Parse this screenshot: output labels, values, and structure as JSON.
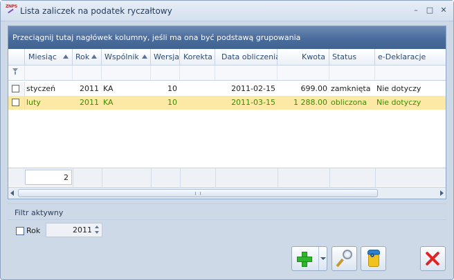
{
  "window": {
    "title": "Lista zaliczek na podatek ryczałtowy",
    "app_icon_label": "ZNPS",
    "controls": {
      "minimize": "–",
      "maximize": "□",
      "close": "✕"
    }
  },
  "grid": {
    "group_hint": "Przeciągnij tutaj nagłówek kolumny, jeśli ma ona być podstawą grupowania",
    "columns": [
      {
        "label": "Miesiąc",
        "sorted": "asc"
      },
      {
        "label": "Rok",
        "sorted": "asc"
      },
      {
        "label": "Wspólnik",
        "sorted": "asc"
      },
      {
        "label": "Wersja",
        "sorted": ""
      },
      {
        "label": "Korekta",
        "sorted": ""
      },
      {
        "label": "Data obliczenia",
        "sorted": ""
      },
      {
        "label": "Kwota",
        "sorted": ""
      },
      {
        "label": "Status",
        "sorted": ""
      },
      {
        "label": "e-Deklaracje",
        "sorted": ""
      }
    ],
    "rows": [
      {
        "miesiac": "styczeń",
        "rok": "2011",
        "wspolnik": "KA",
        "wersja": "10",
        "korekta": "",
        "data": "2011-02-15",
        "kwota": "699.00",
        "status": "zamknięta",
        "edeklaracje": "Nie dotyczy",
        "selected": false,
        "checked": false
      },
      {
        "miesiac": "luty",
        "rok": "2011",
        "wspolnik": "KA",
        "wersja": "10",
        "korekta": "",
        "data": "2011-03-15",
        "kwota": "1 288.00",
        "status": "obliczona",
        "edeklaracje": "Nie dotyczy",
        "selected": true,
        "checked": false
      }
    ],
    "footer_count": "2"
  },
  "filter": {
    "title": "Filtr aktywny",
    "rok_label": "Rok",
    "rok_checked": false,
    "year_value": "2011"
  },
  "toolbar": {
    "add": "add-icon",
    "edit": "magnifier-icon",
    "delete": "trash-icon",
    "close": "close-icon"
  },
  "colors": {
    "header_blue": "#4a6c9d",
    "selected_row": "#fbe9a5",
    "selected_text": "#3f8a00"
  }
}
